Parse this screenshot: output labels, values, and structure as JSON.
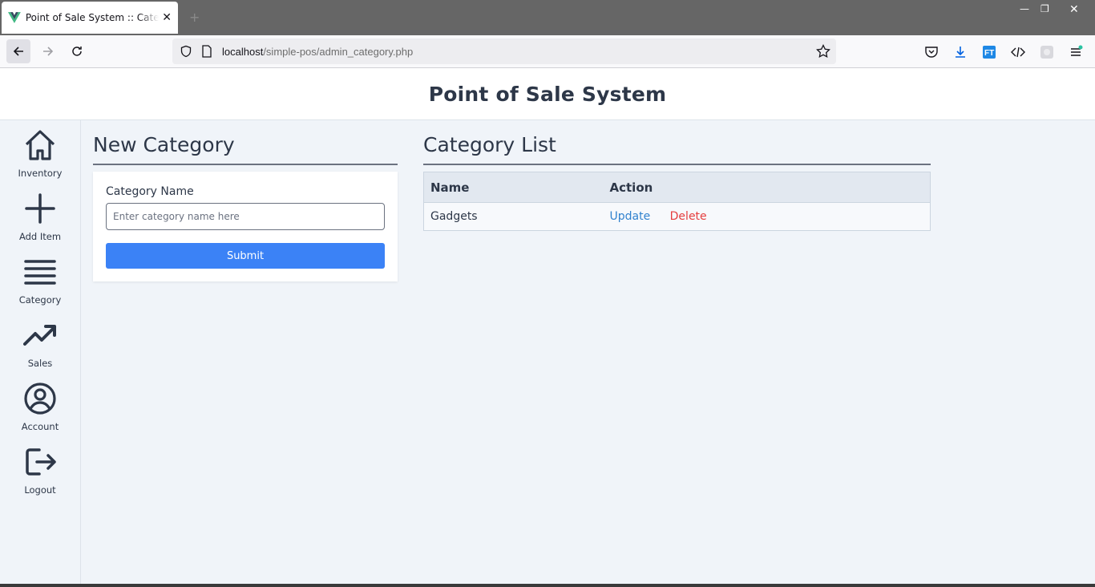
{
  "browser": {
    "tab_title": "Point of Sale System :: Category",
    "new_tab": "+",
    "url_host": "localhost",
    "url_path": "/simple-pos/admin_category.php"
  },
  "app": {
    "title": "Point of Sale System"
  },
  "sidebar": {
    "items": [
      {
        "label": "Inventory",
        "icon": "home-icon"
      },
      {
        "label": "Add Item",
        "icon": "plus-icon"
      },
      {
        "label": "Category",
        "icon": "menu-icon"
      },
      {
        "label": "Sales",
        "icon": "trending-up-icon"
      },
      {
        "label": "Account",
        "icon": "user-circle-icon"
      },
      {
        "label": "Logout",
        "icon": "logout-icon"
      }
    ]
  },
  "new_category": {
    "title": "New Category",
    "field_label": "Category Name",
    "placeholder": "Enter category name here",
    "submit_label": "Submit"
  },
  "category_list": {
    "title": "Category List",
    "columns": [
      "Name",
      "Action"
    ],
    "rows": [
      {
        "name": "Gadgets",
        "update": "Update",
        "delete": "Delete"
      }
    ]
  },
  "colors": {
    "accent": "#3b82f6",
    "update": "#3182ce",
    "delete": "#e53e3e",
    "text": "#2d3748"
  }
}
